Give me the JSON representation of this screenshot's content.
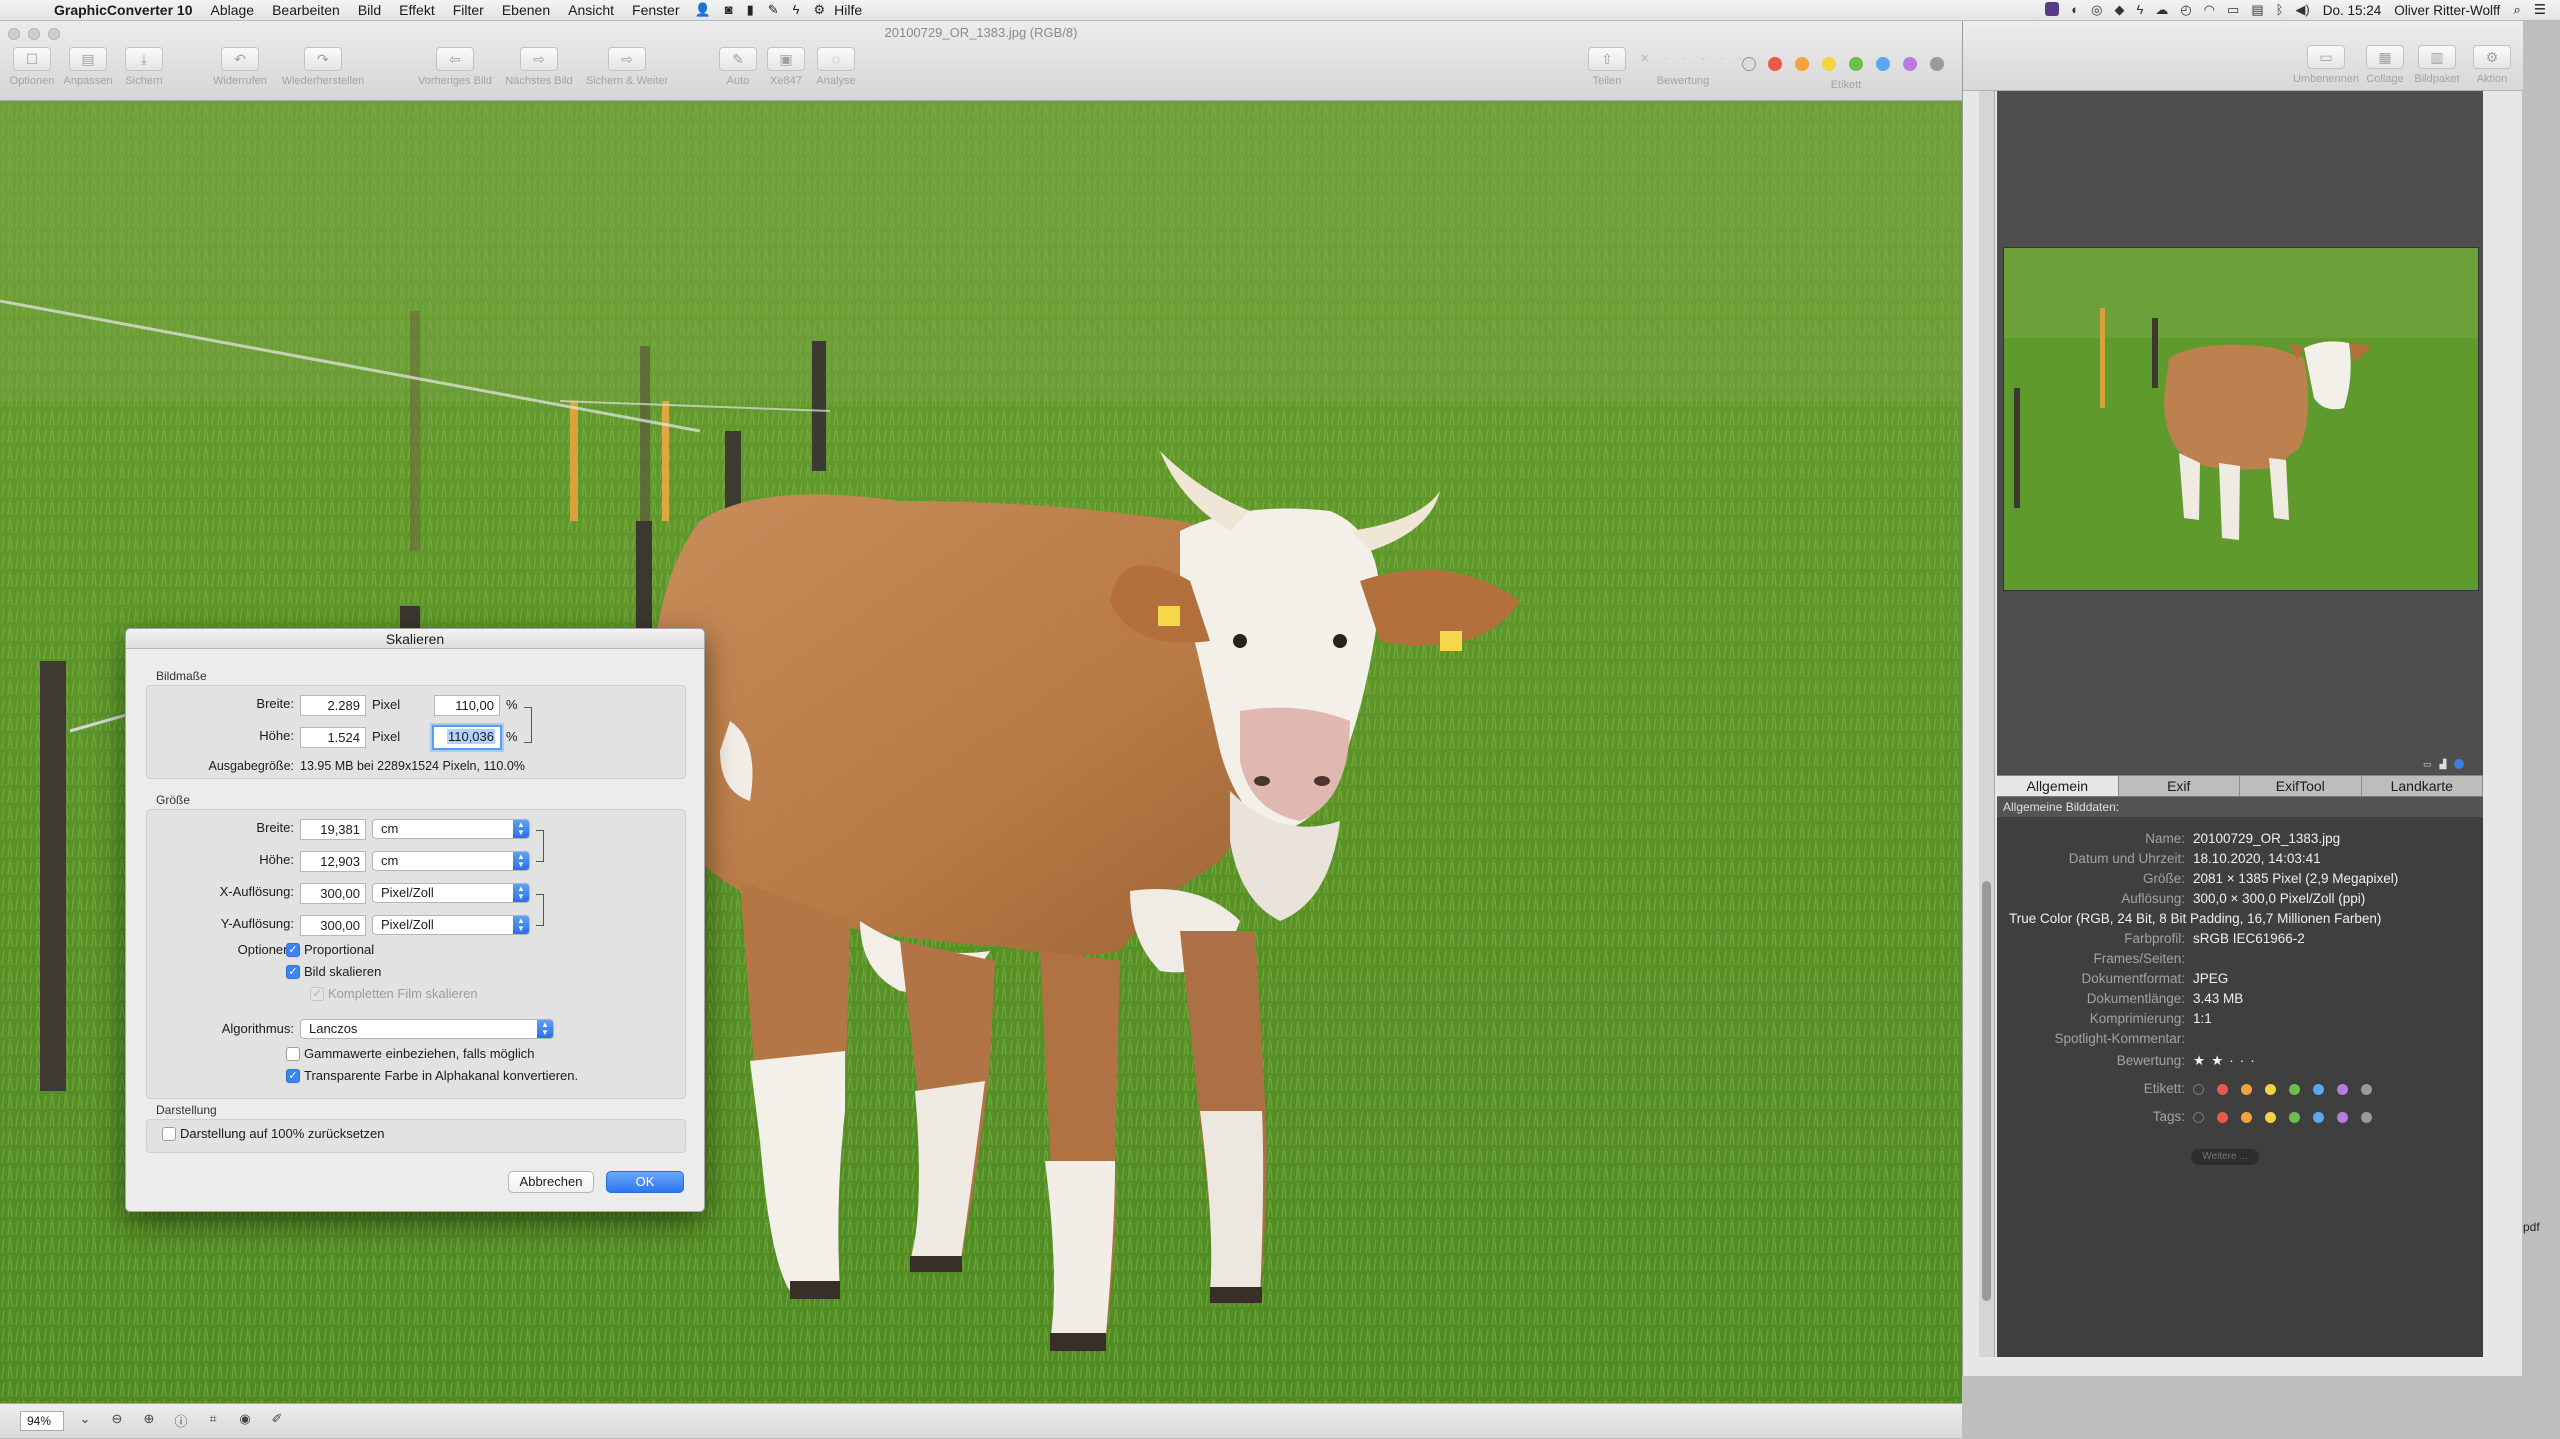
{
  "menubar": {
    "app": "GraphicConverter 10",
    "items": [
      "Ablage",
      "Bearbeiten",
      "Bild",
      "Effekt",
      "Filter",
      "Ebenen",
      "Ansicht",
      "Fenster"
    ],
    "help": "Hilfe",
    "clock": "Do. 15:24",
    "user": "Oliver Ritter-Wolff"
  },
  "window": {
    "title": "20100729_OR_1383.jpg (RGB/8)",
    "toolbar": {
      "optionen": "Optionen",
      "anpassen": "Anpassen",
      "sichern": "Sichern",
      "widerrufen": "Widerrufen",
      "wiederherstellen": "Wiederherstellen",
      "vorheriges": "Vorheriges Bild",
      "naechstes": "Nächstes Bild",
      "sichern_weiter": "Sichern & Weiter",
      "auto": "Auto",
      "xe": "Xe847",
      "analyse": "Analyse",
      "teilen": "Teilen",
      "bewertung": "Bewertung",
      "etikett": "Etikett"
    },
    "label_colors": [
      "#e85a4f",
      "#f3a33a",
      "#f2d43e",
      "#6cc04a",
      "#5aa9f0",
      "#b97be0",
      "#9a9a9a"
    ]
  },
  "status": {
    "zoom": "94%"
  },
  "browser": {
    "toolbar": {
      "umbenennen": "Umbenennen",
      "collage": "Collage",
      "bildpaket": "Bildpaket",
      "aktion": "Aktion"
    },
    "tabs": [
      "Allgemein",
      "Exif",
      "ExifTool",
      "Landkarte"
    ],
    "info_header": "Allgemeine Bilddaten:",
    "rows": [
      {
        "k": "Name:",
        "v": "20100729_OR_1383.jpg"
      },
      {
        "k": "Datum und Uhrzeit:",
        "v": "18.10.2020, 14:03:41"
      },
      {
        "k": "Größe:",
        "v": "2081 × 1385 Pixel (2,9 Megapixel)"
      },
      {
        "k": "Auflösung:",
        "v": "300,0 × 300,0 Pixel/Zoll (ppi)"
      }
    ],
    "color_line": "True Color (RGB, 24 Bit, 8 Bit Padding, 16,7 Millionen Farben)",
    "rows2": [
      {
        "k": "Farbprofil:",
        "v": "sRGB IEC61966-2"
      },
      {
        "k": "Frames/Seiten:",
        "v": ""
      },
      {
        "k": "Dokumentformat:",
        "v": "JPEG"
      },
      {
        "k": "Dokumentlänge:",
        "v": "3.43 MB"
      },
      {
        "k": "Komprimierung:",
        "v": "1:1"
      },
      {
        "k": "Spotlight-Kommentar:",
        "v": ""
      }
    ],
    "rating_label": "Bewertung:",
    "rating_value": 2,
    "etikett_label": "Etikett:",
    "tags_label": "Tags:",
    "weitere": "Weitere ...",
    "edge_text": "pdf"
  },
  "dialog": {
    "title": "Skalieren",
    "bildmasse": {
      "section": "Bildmaße",
      "breite_label": "Breite:",
      "breite_value": "2.289",
      "breite_unit": "Pixel",
      "breite_pct": "110,00",
      "hoehe_label": "Höhe:",
      "hoehe_value": "1.524",
      "hoehe_unit": "Pixel",
      "hoehe_pct": "110,036",
      "pct": "%",
      "ausgabe_label": "Ausgabegröße:",
      "ausgabe_value": "13.95 MB bei 2289x1524 Pixeln, 110.0%"
    },
    "groesse": {
      "section": "Größe",
      "breite_label": "Breite:",
      "breite_value": "19,381",
      "breite_unit": "cm",
      "hoehe_label": "Höhe:",
      "hoehe_value": "12,903",
      "hoehe_unit": "cm",
      "xaufl_label": "X-Auflösung:",
      "xaufl_value": "300,00",
      "xaufl_unit": "Pixel/Zoll",
      "yaufl_label": "Y-Auflösung:",
      "yaufl_value": "300,00",
      "yaufl_unit": "Pixel/Zoll",
      "optionen_label": "Optionen:",
      "proportional": "Proportional",
      "bild_skalieren": "Bild skalieren",
      "film_skalieren": "Kompletten Film skalieren",
      "algo_label": "Algorithmus:",
      "algo_value": "Lanczos",
      "gamma": "Gammawerte einbeziehen, falls möglich",
      "transparent": "Transparente Farbe in Alphakanal konvertieren."
    },
    "darstellung": {
      "section": "Darstellung",
      "reset": "Darstellung auf 100% zurücksetzen"
    },
    "cancel": "Abbrechen",
    "ok": "OK"
  }
}
